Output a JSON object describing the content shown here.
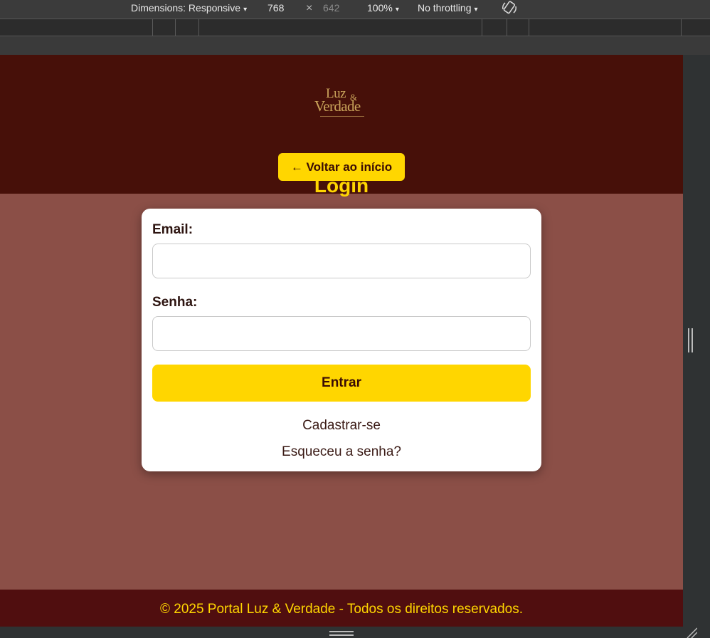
{
  "devtools": {
    "dimensions_label": "Dimensions: Responsive",
    "width_value": "768",
    "times": "×",
    "height_value": "642",
    "zoom": "100%",
    "throttling": "No throttling",
    "caret": "▾"
  },
  "header": {
    "logo_line1": "Luz",
    "logo_amp": "&",
    "logo_line2": "Verdade",
    "back_button": "← Voltar ao início"
  },
  "page_title": "Login",
  "form": {
    "email_label": "Email:",
    "email_value": "",
    "password_label": "Senha:",
    "password_value": "",
    "submit_label": "Entrar",
    "register_link": "Cadastrar-se",
    "forgot_link": "Esqueceu a senha?"
  },
  "footer": {
    "text": "© 2025 Portal Luz & Verdade - Todos os direitos reservados."
  },
  "colors": {
    "header_bg": "#471009",
    "page_bg": "#8b4f47",
    "accent": "#ffd600",
    "footer_bg": "#500e0f"
  }
}
